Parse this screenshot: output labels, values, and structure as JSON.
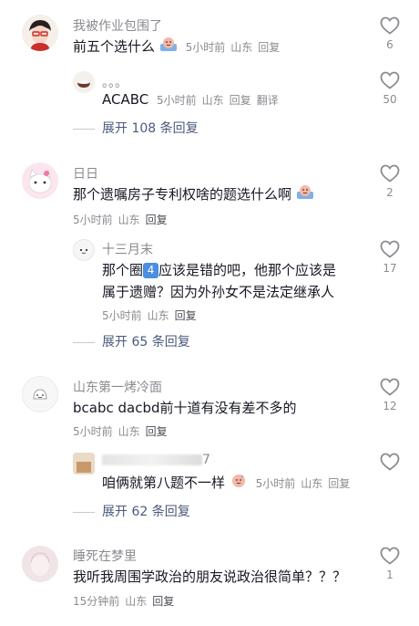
{
  "comments": [
    {
      "user": "我被作业包围了",
      "text": "前五个选什么",
      "time": "5小时前",
      "location": "山东",
      "reply": "回复",
      "likes": "6",
      "replies": [
        {
          "user": "。。。",
          "text": "ACABC",
          "time": "5小时前",
          "location": "山东",
          "reply": "回复",
          "translate": "翻译",
          "likes": "50"
        }
      ],
      "expand": "展开 108 条回复"
    },
    {
      "user": "日日",
      "text": "那个遗嘱房子专利权啥的题选什么啊",
      "time": "5小时前",
      "location": "山东",
      "reply": "回复",
      "likes": "2",
      "replies": [
        {
          "user": "十三月末",
          "text_line1_a": "那个圈",
          "badge": "4",
          "text_line1_b": "应该是错的吧，他那个应该是",
          "text_line2": "属于遗赠？因为外孙女不是法定继承人",
          "time": "5小时前",
          "location": "山东",
          "reply": "回复",
          "likes": "17"
        }
      ],
      "expand": "展开 65 条回复"
    },
    {
      "user": "山东第一烤冷面",
      "text": "bcabc dacbd前十道有没有差不多的",
      "time": "5小时前",
      "location": "山东",
      "reply": "回复",
      "likes": "12",
      "replies": [
        {
          "user_suffix": "7",
          "text": "咱俩就第八题不一样",
          "time": "5小时前",
          "location": "山东",
          "reply": "回复",
          "likes": ""
        }
      ],
      "expand": "展开 62 条回复"
    },
    {
      "user": "睡死在梦里",
      "text": "我听我周围学政治的朋友说政治很简单？？？",
      "time": "15分钟前",
      "location": "山东",
      "reply": "回复",
      "likes": "1"
    }
  ],
  "icons": {
    "like": "heart-outline-icon",
    "emoji_sweat": "sweat-smile-emoji",
    "emoji_bowl": "bowl-icon"
  },
  "colors": {
    "name": "#8a8b91",
    "text": "#161823",
    "expand": "#4a5a7c",
    "badge": "#4a8fe0"
  }
}
